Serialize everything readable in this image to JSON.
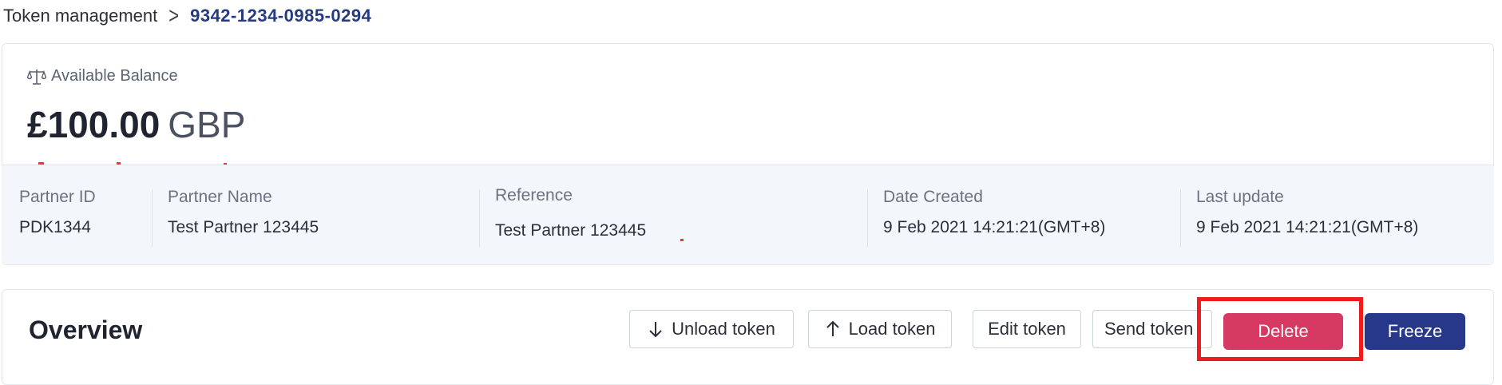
{
  "breadcrumb": {
    "root": "Token management",
    "separator": ">",
    "current": "9342-1234-0985-0294"
  },
  "balance": {
    "icon": "scale-icon",
    "label": "Available Balance",
    "amount": "£100.00",
    "currency": "GBP"
  },
  "info": {
    "partner_id": {
      "label": "Partner ID",
      "value": "PDK1344"
    },
    "partner_name": {
      "label": "Partner Name",
      "value": "Test Partner 123445"
    },
    "reference": {
      "label": "Reference",
      "value": "Test Partner 123445"
    },
    "date_created": {
      "label": "Date Created",
      "value": "9 Feb 2021 14:21:21(GMT+8)"
    },
    "last_update": {
      "label": "Last update",
      "value": "9 Feb 2021 14:21:21(GMT+8)"
    }
  },
  "overview": {
    "title": "Overview",
    "buttons": {
      "unload": "Unload token",
      "load": "Load token",
      "edit": "Edit token",
      "send": "Send token",
      "delete": "Delete",
      "freeze": "Freeze"
    }
  },
  "colors": {
    "accent": "#243a82",
    "delete": "#d63a63",
    "freeze": "#27388a",
    "highlight": "#ee1c1c"
  }
}
